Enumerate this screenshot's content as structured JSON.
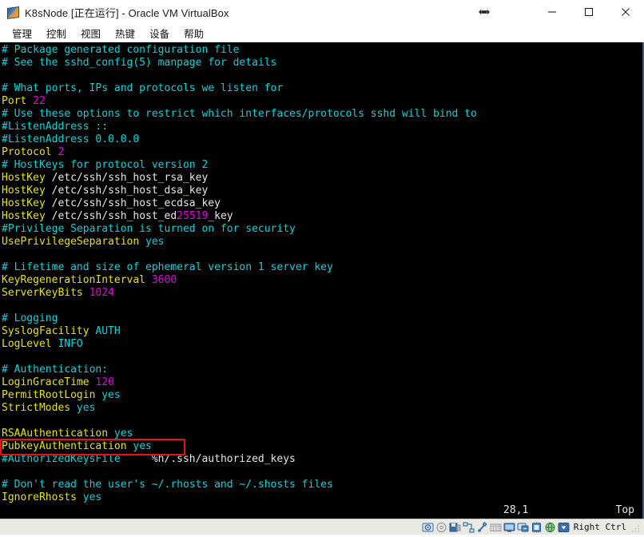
{
  "window": {
    "title": "K8sNode [正在运行] - Oracle VM VirtualBox",
    "app_icon": "virtualbox-logo-icon",
    "controls": {
      "resize": "resize-arrows-icon",
      "minimize": "minimize-icon",
      "maximize": "maximize-icon",
      "close": "close-icon"
    }
  },
  "menubar": {
    "items": [
      {
        "label": "管理",
        "name": "menu-manage"
      },
      {
        "label": "控制",
        "name": "menu-control"
      },
      {
        "label": "视图",
        "name": "menu-view"
      },
      {
        "label": "热键",
        "name": "menu-hotkey"
      },
      {
        "label": "设备",
        "name": "menu-devices"
      },
      {
        "label": "帮助",
        "name": "menu-help"
      }
    ]
  },
  "terminal": {
    "editor": "vim",
    "file": "sshd_config",
    "lines": [
      [
        {
          "t": "# Package generated configuration file",
          "c": "comment"
        }
      ],
      [
        {
          "t": "# See the sshd_config(5) manpage for details",
          "c": "comment"
        }
      ],
      [
        {
          "t": "",
          "c": "plain"
        }
      ],
      [
        {
          "t": "# What ports, IPs and protocols we listen for",
          "c": "comment"
        }
      ],
      [
        {
          "t": "Port ",
          "c": "key"
        },
        {
          "t": "22",
          "c": "num"
        }
      ],
      [
        {
          "t": "# Use these options to restrict which interfaces/protocols sshd will bind to",
          "c": "comment"
        }
      ],
      [
        {
          "t": "#ListenAddress ::",
          "c": "comment"
        }
      ],
      [
        {
          "t": "#ListenAddress 0.0.0.0",
          "c": "comment"
        }
      ],
      [
        {
          "t": "Protocol ",
          "c": "key"
        },
        {
          "t": "2",
          "c": "num"
        }
      ],
      [
        {
          "t": "# HostKeys for protocol version 2",
          "c": "comment"
        }
      ],
      [
        {
          "t": "HostKey",
          "c": "key"
        },
        {
          "t": " /etc/ssh/ssh_host_rsa_key",
          "c": "path"
        }
      ],
      [
        {
          "t": "HostKey",
          "c": "key"
        },
        {
          "t": " /etc/ssh/ssh_host_dsa_key",
          "c": "path"
        }
      ],
      [
        {
          "t": "HostKey",
          "c": "key"
        },
        {
          "t": " /etc/ssh/ssh_host_ecdsa_key",
          "c": "path"
        }
      ],
      [
        {
          "t": "HostKey",
          "c": "key"
        },
        {
          "t": " /etc/ssh/ssh_host_ed",
          "c": "path"
        },
        {
          "t": "25519",
          "c": "num"
        },
        {
          "t": "_key",
          "c": "path"
        }
      ],
      [
        {
          "t": "#Privilege Separation is turned on for security",
          "c": "comment"
        }
      ],
      [
        {
          "t": "UsePrivilegeSeparation ",
          "c": "key"
        },
        {
          "t": "yes",
          "c": "val"
        }
      ],
      [
        {
          "t": "",
          "c": "plain"
        }
      ],
      [
        {
          "t": "# Lifetime and size of ephemeral version 1 server key",
          "c": "comment"
        }
      ],
      [
        {
          "t": "KeyRegenerationInterval ",
          "c": "key"
        },
        {
          "t": "3600",
          "c": "num"
        }
      ],
      [
        {
          "t": "ServerKeyBits ",
          "c": "key"
        },
        {
          "t": "1024",
          "c": "num"
        }
      ],
      [
        {
          "t": "",
          "c": "plain"
        }
      ],
      [
        {
          "t": "# Logging",
          "c": "comment"
        }
      ],
      [
        {
          "t": "SyslogFacility ",
          "c": "key"
        },
        {
          "t": "AUTH",
          "c": "val"
        }
      ],
      [
        {
          "t": "LogLevel ",
          "c": "key"
        },
        {
          "t": "INFO",
          "c": "val"
        }
      ],
      [
        {
          "t": "",
          "c": "plain"
        }
      ],
      [
        {
          "t": "# Authentication:",
          "c": "comment"
        }
      ],
      [
        {
          "t": "LoginGraceTime ",
          "c": "key"
        },
        {
          "t": "120",
          "c": "num"
        }
      ],
      [
        {
          "t": "PermitRootLogin ",
          "c": "key"
        },
        {
          "t": "yes",
          "c": "val"
        }
      ],
      [
        {
          "t": "StrictModes ",
          "c": "key"
        },
        {
          "t": "yes",
          "c": "val"
        }
      ],
      [
        {
          "t": "",
          "c": "plain"
        }
      ],
      [
        {
          "t": "RSAAuthentication ",
          "c": "key"
        },
        {
          "t": "yes",
          "c": "val"
        }
      ],
      [
        {
          "t": "PubkeyAuthentication ",
          "c": "key"
        },
        {
          "t": "yes",
          "c": "val"
        }
      ],
      [
        {
          "t": "#AuthorizedKeysFile",
          "c": "comment"
        },
        {
          "t": "     %h/.ssh/authorized_keys",
          "c": "path"
        }
      ],
      [
        {
          "t": "",
          "c": "plain"
        }
      ],
      [
        {
          "t": "# Don't read the user's ~/.rhosts and ~/.shosts files",
          "c": "comment"
        }
      ],
      [
        {
          "t": "IgnoreRhosts ",
          "c": "key"
        },
        {
          "t": "yes",
          "c": "val"
        }
      ]
    ],
    "ruler": {
      "position": "28,1",
      "scroll": "Top"
    },
    "annotation": {
      "shape": "rectangle",
      "color": "#ee1111",
      "target_text": "PubkeyAuthentication yes"
    }
  },
  "statusbar": {
    "devices": [
      {
        "name": "hard-disk-icon"
      },
      {
        "name": "optical-disk-icon"
      },
      {
        "name": "floppy-disk-icon"
      },
      {
        "name": "network-icon"
      },
      {
        "name": "usb-icon"
      },
      {
        "name": "shared-folder-icon"
      },
      {
        "name": "display-icon"
      },
      {
        "name": "remote-desktop-icon"
      },
      {
        "name": "cpu-icon"
      },
      {
        "name": "settings-globe-icon"
      },
      {
        "name": "host-key-icon"
      }
    ],
    "host_key": "Right Ctrl",
    "resize_grip": "resize-grip-icon"
  }
}
